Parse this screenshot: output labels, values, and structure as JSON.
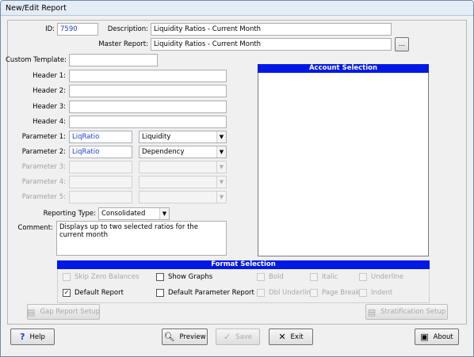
{
  "window": {
    "title": "New/Edit Report"
  },
  "form": {
    "id_label": "ID:",
    "id_value": "7590",
    "description_label": "Description:",
    "description_value": "Liquidity Ratios - Current Month",
    "master_label": "Master Report:",
    "master_value": "Liquidity Ratios - Current Month",
    "browse_label": "...",
    "custom_template_label": "Custom Template:",
    "header1_label": "Header 1:",
    "header2_label": "Header 2:",
    "header3_label": "Header 3:",
    "header4_label": "Header 4:",
    "param1_label": "Parameter 1:",
    "param1_value": "LiqRatio",
    "param1_select": "Liquidity",
    "param2_label": "Parameter 2:",
    "param2_value": "LiqRatio",
    "param2_select": "Dependency",
    "param3_label": "Parameter 3:",
    "param4_label": "Parameter 4:",
    "param5_label": "Parameter 5:",
    "reporting_type_label": "Reporting Type:",
    "reporting_type_value": "Consolidated",
    "comment_label": "Comment:",
    "comment_value": "Displays up to two selected ratios for the current month"
  },
  "account_selection": {
    "title": "Account Selection"
  },
  "format_selection": {
    "title": "Format Selection",
    "skip_zero": "Skip Zero Balances",
    "show_graphs": "Show Graphs",
    "bold": "Bold",
    "italic": "Italic",
    "underline": "Underline",
    "default_report": "Default Report",
    "default_param_report": "Default Parameter Report",
    "dbl_underline": "Dbl Underline",
    "page_break": "Page Break",
    "indent": "Indent"
  },
  "buttons": {
    "gap_report": "Gap Report Setup",
    "stratification": "Stratification Setup",
    "help": "Help",
    "preview": "Preview",
    "save": "Save",
    "exit": "Exit",
    "about": "About"
  }
}
